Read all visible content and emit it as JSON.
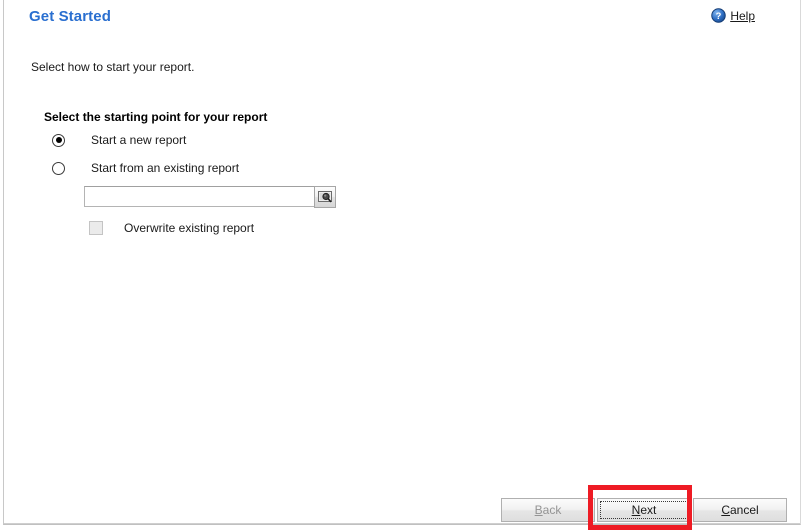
{
  "header": {
    "title": "Get Started",
    "help": {
      "label_accesskey": "H",
      "label_rest": "elp",
      "icon": "help-circle-icon"
    }
  },
  "intro": {
    "text": "Select how to start your report."
  },
  "group": {
    "heading": "Select the starting point for your report",
    "options": [
      {
        "label": "Start a new report",
        "selected": true
      },
      {
        "label": "Start from an existing report",
        "selected": false
      }
    ]
  },
  "picker": {
    "value": "",
    "placeholder": "",
    "browse_icon": "search-browse-icon"
  },
  "overwrite": {
    "label": "Overwrite existing report",
    "checked": false
  },
  "footer": {
    "buttons": [
      {
        "name": "back",
        "accesskey": "B",
        "rest": "ack",
        "state": "disabled"
      },
      {
        "name": "next",
        "accesskey": "N",
        "prefix": "",
        "rest": "ext",
        "state": "focused"
      },
      {
        "name": "cancel",
        "accesskey": "C",
        "rest": "ancel",
        "state": "enabled"
      }
    ]
  },
  "annotation": {
    "target": "next-button",
    "color": "#ee1b24"
  },
  "colors": {
    "title_blue": "#2a6fd0",
    "text": "#1a1a1a",
    "disabled_text": "#949494",
    "highlight_red": "#ee1b24"
  }
}
